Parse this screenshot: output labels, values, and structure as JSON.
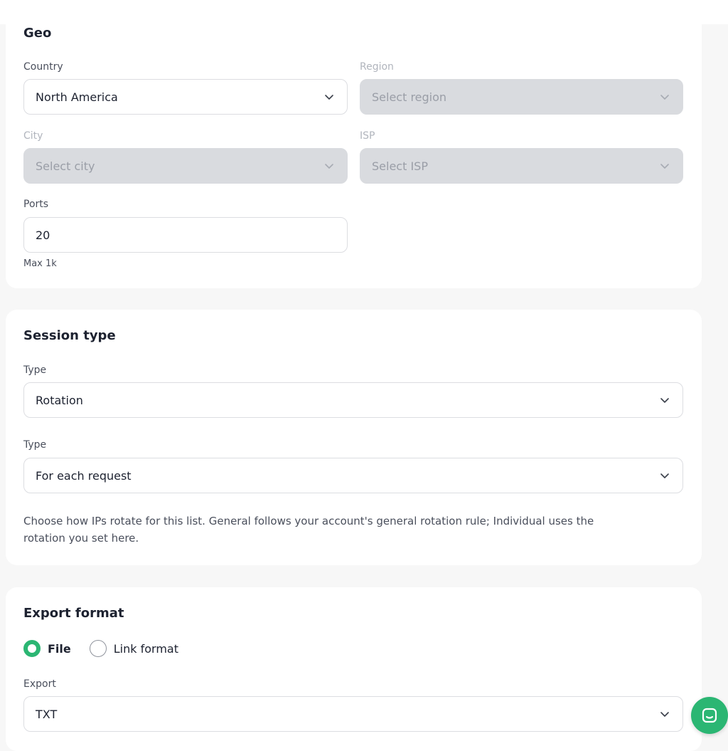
{
  "geo": {
    "title": "Geo",
    "country": {
      "label": "Country",
      "value": "North America"
    },
    "region": {
      "label": "Region",
      "placeholder": "Select region"
    },
    "city": {
      "label": "City",
      "placeholder": "Select city"
    },
    "isp": {
      "label": "ISP",
      "placeholder": "Select ISP"
    },
    "ports": {
      "label": "Ports",
      "value": "20",
      "hint": "Max 1k"
    }
  },
  "session": {
    "title": "Session type",
    "type1": {
      "label": "Type",
      "value": "Rotation"
    },
    "type2": {
      "label": "Type",
      "value": "For each request"
    },
    "description": "Choose how IPs rotate for this list. General follows your account's general rotation rule; Individual uses the rotation you set here."
  },
  "export": {
    "title": "Export format",
    "options": [
      {
        "label": "File",
        "selected": true
      },
      {
        "label": "Link format",
        "selected": false
      }
    ],
    "export_field": {
      "label": "Export",
      "value": "TXT"
    }
  },
  "colors": {
    "accent": "#2bb673",
    "disabled": "#d9dbdf",
    "border": "#dcdde1"
  },
  "icons": {
    "dropdown": "chevron-down-icon",
    "chat": "chat-icon"
  }
}
